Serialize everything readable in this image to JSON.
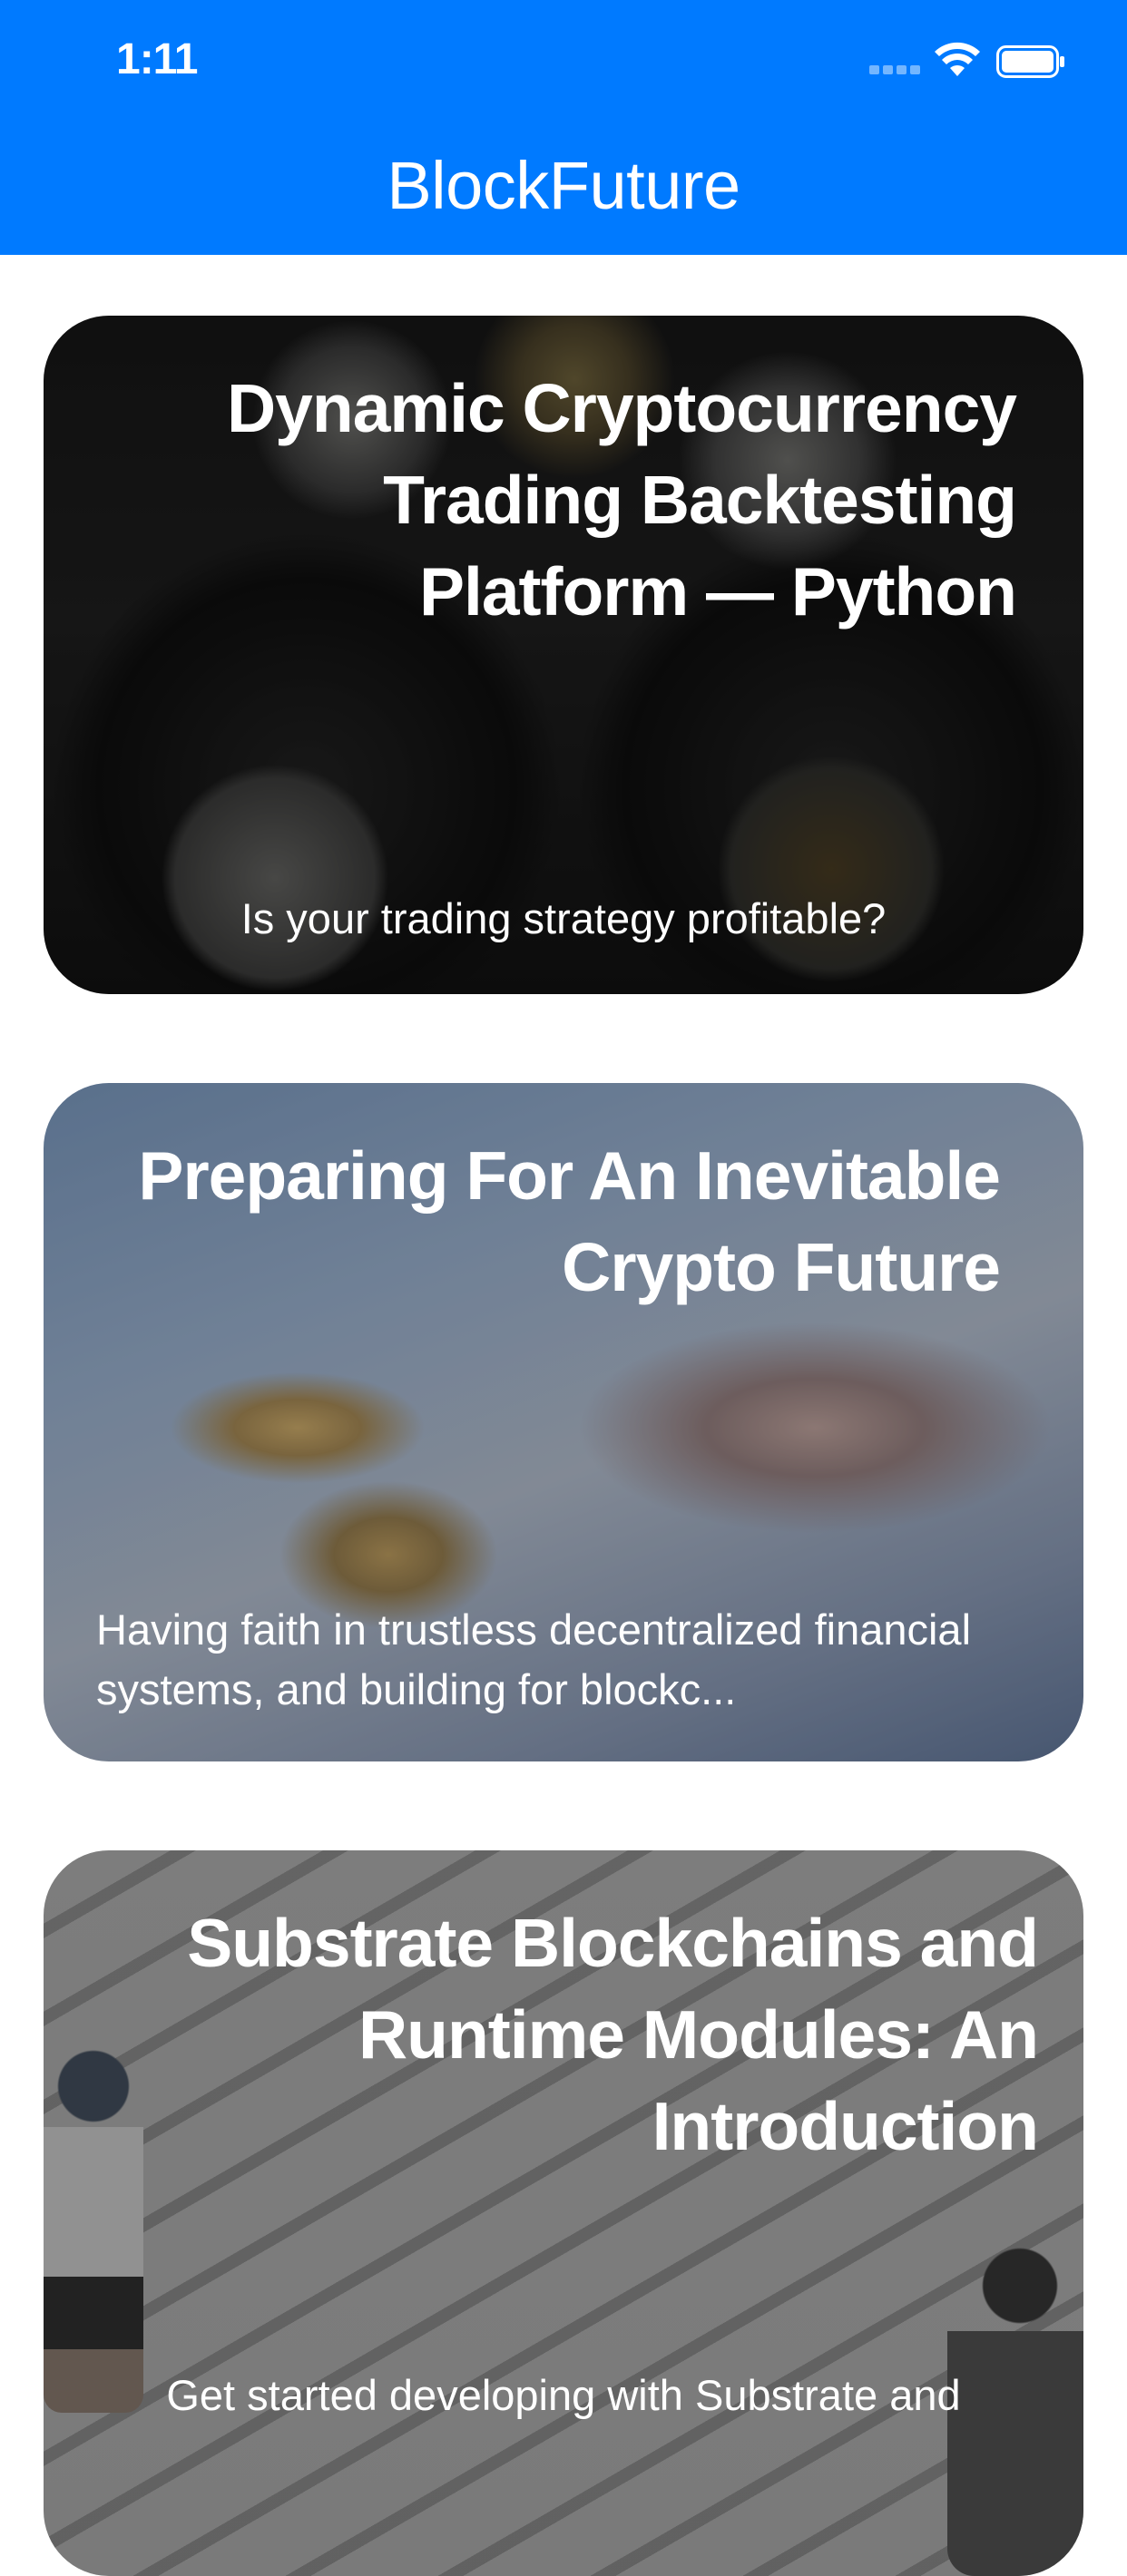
{
  "status_bar": {
    "time": "1:11"
  },
  "nav": {
    "title": "BlockFuture",
    "background_color": "#007aff"
  },
  "articles": [
    {
      "title": "Dynamic Cryptocurrency Trading Backtesting Platform — Python",
      "subtitle": "Is your trading strategy profitable?"
    },
    {
      "title": "Preparing For An Inevitable Crypto Future",
      "subtitle": "Having faith in trustless decentralized financial systems, and building for blockc..."
    },
    {
      "title": "Substrate Blockchains and Runtime Modules: An Introduction",
      "subtitle": "Get started developing with Substrate and"
    }
  ]
}
